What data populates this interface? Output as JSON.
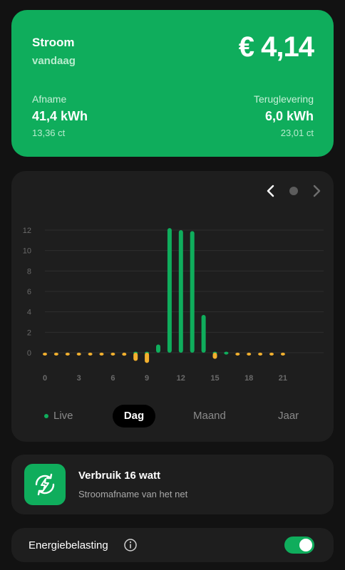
{
  "summary": {
    "title": "Stroom",
    "period": "vandaag",
    "amount": "€ 4,14",
    "afname": {
      "label": "Afname",
      "value": "41,4 kWh",
      "price": "13,36 ct"
    },
    "teruglevering": {
      "label": "Teruglevering",
      "value": "6,0 kWh",
      "price": "23,01 ct"
    }
  },
  "colors": {
    "accent": "#0fad5c",
    "return": "#f2b02e",
    "background": "#121212",
    "card": "#1e1e1e"
  },
  "nav": {
    "prev_icon": "chevron-left-icon",
    "next_icon": "chevron-right-icon"
  },
  "chart_data": {
    "type": "bar",
    "x": [
      0,
      1,
      2,
      3,
      4,
      5,
      6,
      7,
      8,
      9,
      10,
      11,
      12,
      13,
      14,
      15,
      16,
      17,
      18,
      19,
      20,
      21
    ],
    "xticks": [
      "0",
      "3",
      "6",
      "9",
      "12",
      "15",
      "18",
      "21"
    ],
    "yticks": [
      "0",
      "2",
      "4",
      "6",
      "8",
      "10",
      "12"
    ],
    "ylim": [
      -1,
      12
    ],
    "grid": true,
    "series": [
      {
        "color": "#0fad5c",
        "values": [
          0,
          0,
          0,
          0,
          0,
          0,
          0,
          0,
          0.1,
          0.1,
          0.8,
          12.2,
          12.0,
          11.9,
          3.7,
          0.1,
          0.1,
          0,
          0,
          0,
          0,
          0
        ]
      },
      {
        "color": "#f2b02e",
        "values": [
          -0.2,
          -0.2,
          -0.2,
          -0.2,
          -0.2,
          -0.2,
          -0.2,
          -0.3,
          -0.8,
          -1.0,
          0,
          0,
          0,
          0,
          0,
          -0.6,
          0,
          -0.1,
          -0.1,
          -0.1,
          -0.1,
          -0.1
        ]
      }
    ]
  },
  "tabs": {
    "live": "Live",
    "dag": "Dag",
    "maand": "Maand",
    "jaar": "Jaar"
  },
  "usage": {
    "title": "Verbruik 16 watt",
    "subtitle": "Stroomafname van het net",
    "icon": "bolt-cycle-icon"
  },
  "tax": {
    "label": "Energiebelasting",
    "toggle_on": true
  }
}
